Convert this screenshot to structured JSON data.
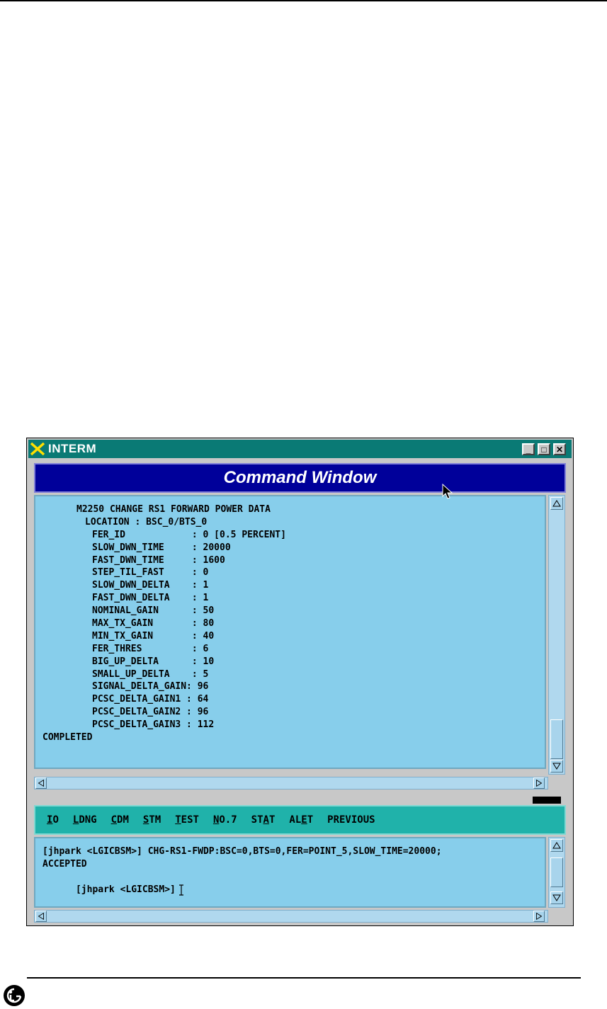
{
  "window": {
    "title": "INTERM",
    "buttons": {
      "minimize": "_",
      "maximize": "□",
      "close": "✕"
    }
  },
  "header": {
    "title": "Command Window"
  },
  "output": {
    "heading": "M2250 CHANGE RS1 FORWARD POWER DATA",
    "location": "LOCATION : BSC_0/BTS_0",
    "rows": [
      "FER_ID            : 0 [0.5 PERCENT]",
      "SLOW_DWN_TIME     : 20000",
      "FAST_DWN_TIME     : 1600",
      "STEP_TIL_FAST     : 0",
      "SLOW_DWN_DELTA    : 1",
      "FAST_DWN_DELTA    : 1",
      "NOMINAL_GAIN      : 50",
      "MAX_TX_GAIN       : 80",
      "MIN_TX_GAIN       : 40",
      "FER_THRES         : 6",
      "BIG_UP_DELTA      : 10",
      "SMALL_UP_DELTA    : 5",
      "SIGNAL_DELTA_GAIN: 96",
      "PCSC_DELTA_GAIN1 : 64",
      "PCSC_DELTA_GAIN2 : 96",
      "PCSC_DELTA_GAIN3 : 112"
    ],
    "footer": "COMPLETED"
  },
  "menu": {
    "items": [
      {
        "pre": "",
        "key": "I",
        "post": "O"
      },
      {
        "pre": "",
        "key": "L",
        "post": "DNG"
      },
      {
        "pre": "",
        "key": "C",
        "post": "DM"
      },
      {
        "pre": "",
        "key": "S",
        "post": "TM"
      },
      {
        "pre": "",
        "key": "T",
        "post": "EST"
      },
      {
        "pre": "",
        "key": "N",
        "post": "O.7"
      },
      {
        "pre": "ST",
        "key": "A",
        "post": "T"
      },
      {
        "pre": "AL",
        "key": "E",
        "post": "T"
      },
      {
        "pre": "",
        "key": "",
        "post": "PREVIOUS"
      }
    ]
  },
  "console": {
    "lines": [
      "[jhpark <LGICBSM>] CHG-RS1-FWDP:BSC=0,BTS=0,FER=POINT_5,SLOW_TIME=20000;",
      "ACCEPTED"
    ],
    "prompt": "[jhpark <LGICBSM>]"
  }
}
